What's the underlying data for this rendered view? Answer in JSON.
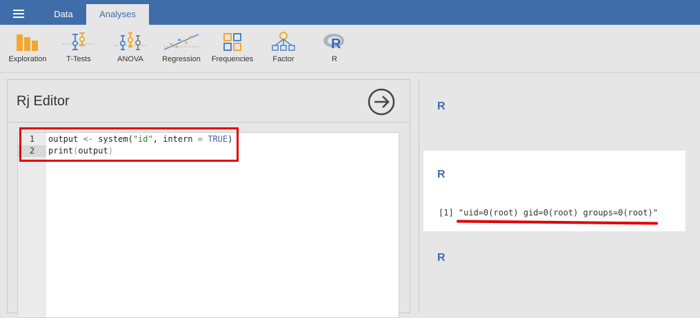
{
  "topbar": {
    "tabs": [
      {
        "label": "Data"
      },
      {
        "label": "Analyses"
      }
    ]
  },
  "ribbon": {
    "items": [
      {
        "label": "Exploration",
        "icon": "bar-chart-icon"
      },
      {
        "label": "T-Tests",
        "icon": "t-test-icon"
      },
      {
        "label": "ANOVA",
        "icon": "anova-icon"
      },
      {
        "label": "Regression",
        "icon": "regression-icon"
      },
      {
        "label": "Frequencies",
        "icon": "frequencies-icon"
      },
      {
        "label": "Factor",
        "icon": "factor-icon"
      },
      {
        "label": "R",
        "icon": "r-logo-icon"
      }
    ]
  },
  "editor": {
    "title": "Rj Editor",
    "line_numbers": [
      "1",
      "2"
    ],
    "lines": [
      [
        "output ",
        "<-",
        " system(",
        "\"id\"",
        ", intern ",
        "=",
        " ",
        "TRUE",
        ")"
      ],
      [
        "print",
        "(",
        "output",
        ")"
      ]
    ]
  },
  "results": {
    "headings": [
      "R",
      "R",
      "R"
    ],
    "output_prefix": "[1]",
    "output_value": "\"uid=0(root) gid=0(root) groups=0(root)\""
  },
  "colors": {
    "accent": "#3e6da9",
    "annotation_red": "#e00000",
    "icon_orange": "#f0a830",
    "icon_blue": "#4a86c8"
  }
}
